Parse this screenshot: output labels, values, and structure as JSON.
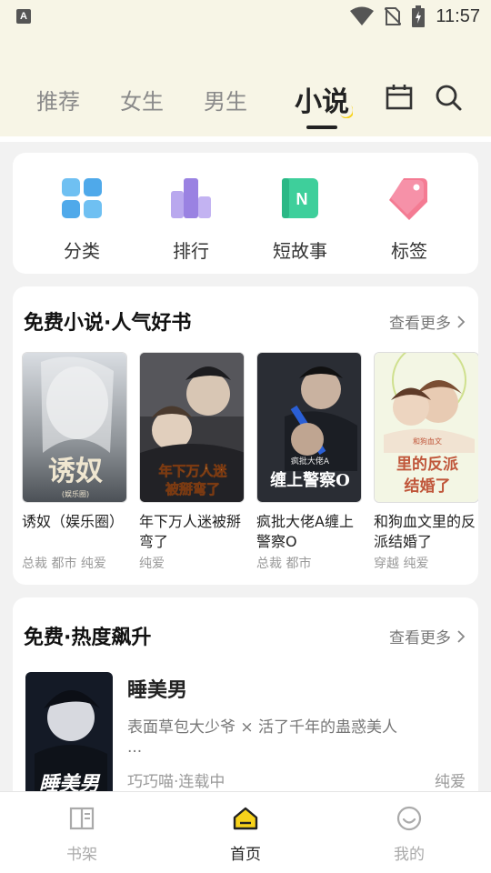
{
  "status_bar": {
    "app_badge": "A",
    "time": "11:57"
  },
  "header": {
    "tabs": [
      {
        "label": "推荐",
        "active": false
      },
      {
        "label": "女生",
        "active": false
      },
      {
        "label": "男生",
        "active": false
      },
      {
        "label": "小说",
        "active": true
      }
    ],
    "icons": [
      "calendar-icon",
      "search-icon"
    ]
  },
  "quick_nav": [
    {
      "label": "分类",
      "icon": "category-grid-icon",
      "color": "#6fc0f2"
    },
    {
      "label": "排行",
      "icon": "ranking-bars-icon",
      "color": "#a892e6"
    },
    {
      "label": "短故事",
      "icon": "short-story-icon",
      "color": "#3ecf9b",
      "icon_letter": "N"
    },
    {
      "label": "标签",
      "icon": "tag-icon",
      "color": "#f47b93"
    }
  ],
  "free_novels": {
    "title": "免费小说·人气好书",
    "more": "查看更多",
    "books": [
      {
        "title": "诱奴（娱乐圈）",
        "tags": "总裁 都市 纯爱",
        "cover_text": "诱奴",
        "cover_sub": "(娱乐圈)"
      },
      {
        "title": "年下万人迷被掰弯了",
        "tags": "纯爱",
        "cover_text": "年下万人迷被掰弯了"
      },
      {
        "title": "疯批大佬A缠上警察O",
        "tags": "总裁 都市",
        "cover_text": "缠上警察O",
        "cover_sub": "疯批大佬A"
      },
      {
        "title": "和狗血文里的反派结婚了",
        "tags": "穿越 纯爱",
        "cover_text": "里的反派结婚了",
        "cover_sub": "和狗血文"
      }
    ]
  },
  "hot_rising": {
    "title": "免费·热度飙升",
    "more": "查看更多",
    "book": {
      "title": "睡美男",
      "desc": "表面草包大少爷 × 活了千年的蛊惑美人",
      "ellipsis": "...",
      "author_status": "巧巧喵·连载中",
      "tag": "纯爱",
      "cover_text": "睡美男"
    }
  },
  "bottom_nav": [
    {
      "label": "书架",
      "icon": "bookshelf-icon",
      "active": false
    },
    {
      "label": "首页",
      "icon": "home-icon",
      "active": true
    },
    {
      "label": "我的",
      "icon": "profile-smile-icon",
      "active": false
    }
  ],
  "colors": {
    "header_bg": "#f7f5e6",
    "accent_yellow": "#f7d21b"
  }
}
